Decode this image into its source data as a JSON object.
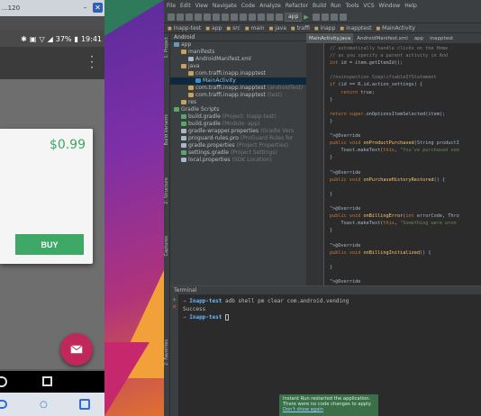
{
  "emulator": {
    "title": "...120",
    "status_time": "19:41",
    "battery": "37%",
    "dialog": {
      "price": "$0.99",
      "buy_label": "BUY"
    }
  },
  "ide": {
    "menu": [
      "File",
      "Edit",
      "View",
      "Navigate",
      "Code",
      "Analyze",
      "Refactor",
      "Build",
      "Run",
      "Tools",
      "VCS",
      "Window",
      "Help"
    ],
    "run_config": "app",
    "breadcrumbs": [
      "Inapp-test",
      "app",
      "src",
      "main",
      "java",
      "traffi",
      "inapp",
      "inapptest",
      "MainActivity"
    ],
    "project_view": "Android",
    "tree": [
      {
        "label": "app",
        "indent": 0,
        "color": "#6897bb"
      },
      {
        "label": "manifests",
        "indent": 1,
        "color": "#c5a35a"
      },
      {
        "label": "AndroidManifest.xml",
        "indent": 2,
        "color": "#a9b7c6"
      },
      {
        "label": "java",
        "indent": 1,
        "color": "#c5a35a"
      },
      {
        "label": "com.traffi.inapp.inapptest",
        "indent": 2,
        "color": "#c5a35a"
      },
      {
        "label": "MainActivity",
        "indent": 3,
        "color": "#3592c4",
        "selected": true
      },
      {
        "label": "com.traffi.inapp.inapptest",
        "indent": 2,
        "color": "#c5a35a",
        "note": "(androidTest)"
      },
      {
        "label": "com.traffi.inapp.inapptest",
        "indent": 2,
        "color": "#c5a35a",
        "note": "(test)"
      },
      {
        "label": "res",
        "indent": 1,
        "color": "#c5a35a"
      },
      {
        "label": "Gradle Scripts",
        "indent": 0,
        "color": "#59a869"
      },
      {
        "label": "build.gradle",
        "indent": 1,
        "color": "#59a869",
        "note": "(Project: Inapp-test)"
      },
      {
        "label": "build.gradle",
        "indent": 1,
        "color": "#59a869",
        "note": "(Module: app)"
      },
      {
        "label": "gradle-wrapper.properties",
        "indent": 1,
        "color": "#a9b7c6",
        "note": "(Gradle Vers"
      },
      {
        "label": "proguard-rules.pro",
        "indent": 1,
        "color": "#a9b7c6",
        "note": "(ProGuard Rules for"
      },
      {
        "label": "gradle.properties",
        "indent": 1,
        "color": "#a9b7c6",
        "note": "(Project Properties)"
      },
      {
        "label": "settings.gradle",
        "indent": 1,
        "color": "#59a869",
        "note": "(Project Settings)"
      },
      {
        "label": "local.properties",
        "indent": 1,
        "color": "#a9b7c6",
        "note": "(SDK Location)"
      }
    ],
    "tabs": [
      "MainActivity.java",
      "AndroidManifest.xml",
      "app",
      "inapptest"
    ],
    "code_lines": [
      "// automatically handle clicks on the Home",
      "// as you specify a parent activity in And",
      "int id = item.getItemId();",
      "",
      "//noinspection SimplifiableIfStatement",
      "if (id == R.id.action_settings) {",
      "    return true;",
      "}",
      "",
      "return super.onOptionsItemSelected(item);",
      "}",
      "",
      "@Override",
      "public void onProductPurchased(String productI",
      "    Toast.makeText(this, \"You've purchased som",
      "}",
      "",
      "@Override",
      "public void onPurchaseHistoryRestored() {",
      "",
      "}",
      "",
      "@Override",
      "public void onBillingError(int errorCode, Thro",
      "    Toast.makeText(this, \"Something were wron",
      "}",
      "",
      "@Override",
      "public void onBillingInitialized() {",
      "",
      "}",
      "",
      "@Override"
    ],
    "terminal": {
      "title": "Terminal",
      "lines": [
        {
          "host": "Inapp-test",
          "text": "adb shell pm clear com.android.vending"
        },
        {
          "host": "",
          "text": "Success"
        },
        {
          "host": "Inapp-test",
          "text": ""
        }
      ]
    },
    "toast": {
      "line1": "Instant Run restarted the application.",
      "line2": "There were no code changes to apply.",
      "link": "Don't show again"
    },
    "side_labels": [
      "1: Project",
      "Build Variants",
      "2: Structure",
      "Captures",
      "2: Favorites"
    ]
  }
}
